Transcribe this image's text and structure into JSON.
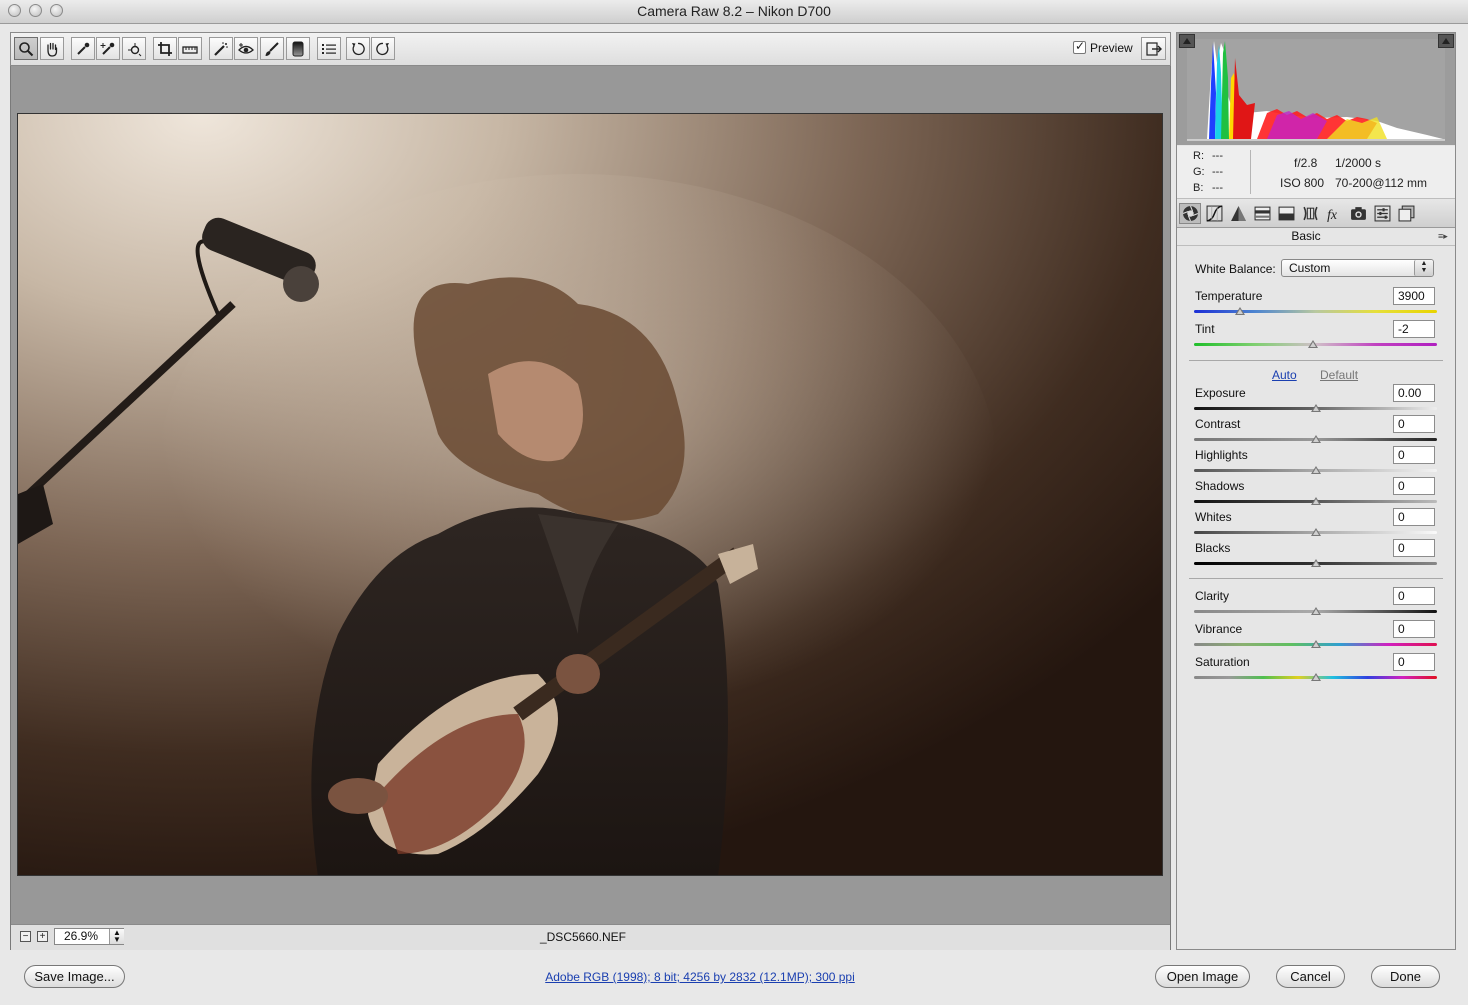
{
  "window": {
    "title": "Camera Raw 8.2  –  Nikon D700"
  },
  "toolbar": {
    "tools": [
      {
        "name": "zoom-tool",
        "icon": "magnifier-icon"
      },
      {
        "name": "hand-tool",
        "icon": "hand-icon"
      },
      {
        "name": "white-balance-tool",
        "icon": "eyedropper-icon"
      },
      {
        "name": "color-sampler-tool",
        "icon": "color-sampler-icon"
      },
      {
        "name": "targeted-adjustment-tool",
        "icon": "target-adjust-icon"
      },
      {
        "name": "crop-tool",
        "icon": "crop-icon"
      },
      {
        "name": "straighten-tool",
        "icon": "straighten-icon"
      },
      {
        "name": "spot-removal-tool",
        "icon": "spot-removal-icon"
      },
      {
        "name": "red-eye-tool",
        "icon": "red-eye-icon"
      },
      {
        "name": "adjustment-brush-tool",
        "icon": "brush-icon"
      },
      {
        "name": "graduated-filter-tool",
        "icon": "graduated-filter-icon"
      },
      {
        "name": "preferences-button",
        "icon": "list-icon"
      },
      {
        "name": "rotate-left-button",
        "icon": "rotate-ccw-icon"
      },
      {
        "name": "rotate-right-button",
        "icon": "rotate-cw-icon"
      }
    ],
    "preview_label": "Preview",
    "preview_checked": true
  },
  "status": {
    "zoom_value": "26.9%",
    "filename": "_DSC5660.NEF"
  },
  "info": {
    "r_label": "R:",
    "g_label": "G:",
    "b_label": "B:",
    "r_value": "---",
    "g_value": "---",
    "b_value": "---",
    "aperture": "f/2.8",
    "shutter": "1/2000 s",
    "iso": "ISO 800",
    "lens": "70-200@112 mm"
  },
  "panel": {
    "title": "Basic",
    "white_balance_label": "White Balance:",
    "white_balance_value": "Custom",
    "auto_label": "Auto",
    "default_label": "Default",
    "sliders": {
      "temperature": {
        "label": "Temperature",
        "value": "3900",
        "position": 0.19
      },
      "tint": {
        "label": "Tint",
        "value": "-2",
        "position": 0.49
      },
      "exposure": {
        "label": "Exposure",
        "value": "0.00",
        "position": 0.5
      },
      "contrast": {
        "label": "Contrast",
        "value": "0",
        "position": 0.5
      },
      "highlights": {
        "label": "Highlights",
        "value": "0",
        "position": 0.5
      },
      "shadows": {
        "label": "Shadows",
        "value": "0",
        "position": 0.5
      },
      "whites": {
        "label": "Whites",
        "value": "0",
        "position": 0.5
      },
      "blacks": {
        "label": "Blacks",
        "value": "0",
        "position": 0.5
      },
      "clarity": {
        "label": "Clarity",
        "value": "0",
        "position": 0.5
      },
      "vibrance": {
        "label": "Vibrance",
        "value": "0",
        "position": 0.5
      },
      "saturation": {
        "label": "Saturation",
        "value": "0",
        "position": 0.5
      }
    }
  },
  "footer": {
    "save_label": "Save Image...",
    "workflow_link": "Adobe RGB (1998); 8 bit; 4256 by 2832 (12.1MP); 300 ppi",
    "open_label": "Open Image",
    "cancel_label": "Cancel",
    "done_label": "Done"
  },
  "colors": {
    "link": "#1a3fb0",
    "histogram_bg": "#9c9c9c",
    "photo_warm_light": "#e9ddce",
    "photo_dark": "#2a1a12"
  }
}
